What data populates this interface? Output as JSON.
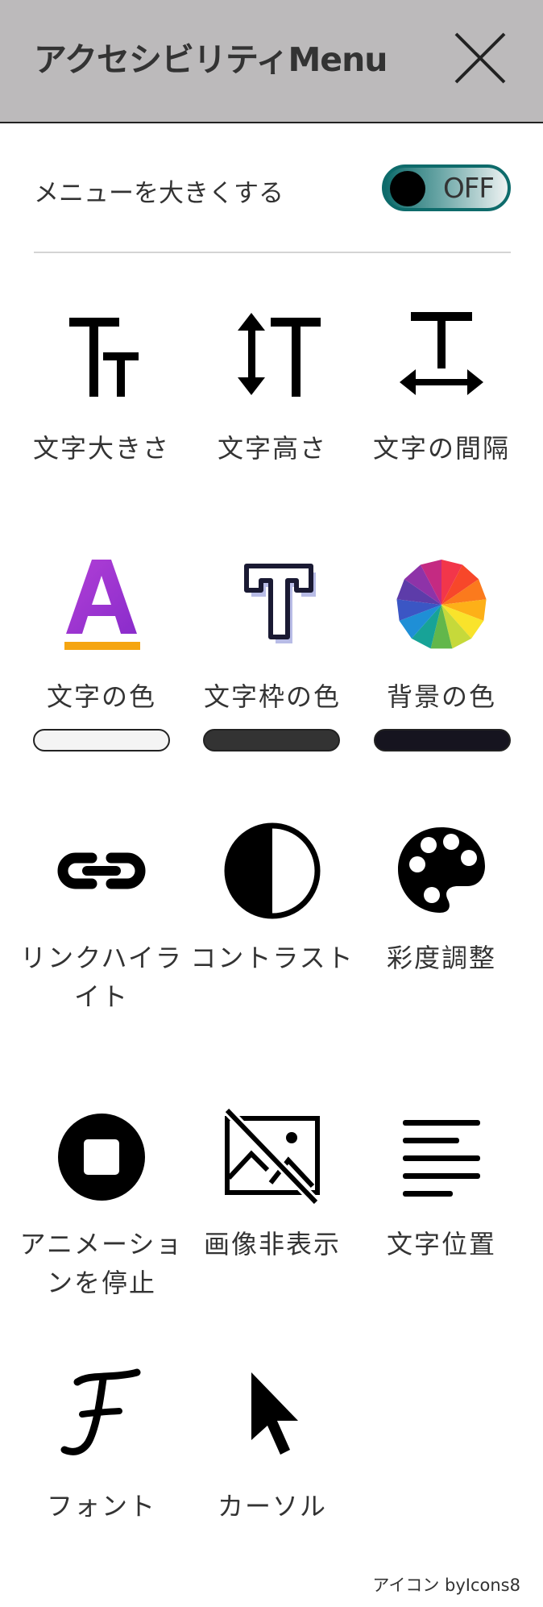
{
  "header": {
    "title": "アクセシビリティMenu"
  },
  "toggle": {
    "label": "メニューを大きくする",
    "state": "OFF"
  },
  "items": [
    {
      "label": "文字大きさ",
      "icon": "text-size-icon"
    },
    {
      "label": "文字高さ",
      "icon": "text-height-icon"
    },
    {
      "label": "文字の間隔",
      "icon": "text-spacing-icon"
    },
    {
      "label": "文字の色",
      "icon": "text-color-icon"
    },
    {
      "label": "文字枠の色",
      "icon": "text-outline-color-icon"
    },
    {
      "label": "背景の色",
      "icon": "color-wheel-icon"
    },
    {
      "label": "リンクハイライト",
      "icon": "link-icon"
    },
    {
      "label": "コントラスト",
      "icon": "contrast-icon"
    },
    {
      "label": "彩度調整",
      "icon": "palette-icon"
    },
    {
      "label": "アニメーションを停止",
      "icon": "stop-icon"
    },
    {
      "label": "画像非表示",
      "icon": "hide-image-icon"
    },
    {
      "label": "文字位置",
      "icon": "align-left-icon"
    },
    {
      "label": "フォント",
      "icon": "font-icon"
    },
    {
      "label": "カーソル",
      "icon": "cursor-icon"
    }
  ],
  "swatches": {
    "text_color": "#f4f4f4",
    "text_outline_color": "#333333",
    "background_color": "#16141f"
  },
  "footer": {
    "credit": "アイコン byIcons8"
  }
}
